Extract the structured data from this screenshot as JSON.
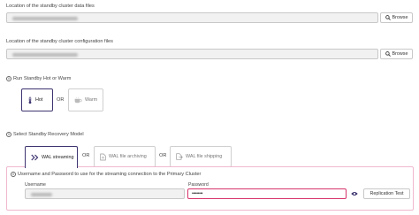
{
  "data_files": {
    "label": "Location of the standby cluster data files",
    "browse_label": "Browse"
  },
  "config_files": {
    "label": "Location of the standby cluster configuration files",
    "browse_label": "Browse"
  },
  "run_mode": {
    "label": "Run Standby Hot or Warm",
    "or": "OR",
    "options": [
      "Hot",
      "Warm"
    ]
  },
  "recovery": {
    "label": "Select Standby Recovery Model",
    "or": "OR",
    "options": [
      "WAL streaming",
      "WAL file archiving",
      "WAL file shipping"
    ]
  },
  "streaming": {
    "label": "Username and Password to use for the streaming connection to the Primary Cluster",
    "username_label": "Username",
    "password_label": "Password",
    "password_value": "•••••••••",
    "replication_test": "Replication Test"
  },
  "colors": {
    "accent": "#3c3470",
    "panel_border": "#f0b7cf",
    "pink": "#d6336c"
  }
}
